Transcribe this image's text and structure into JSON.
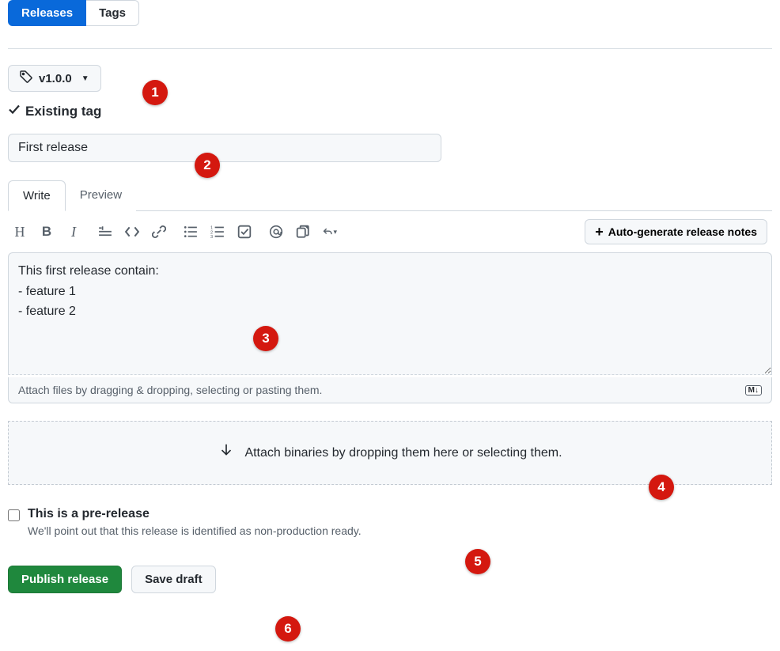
{
  "topTabs": {
    "releases": "Releases",
    "tags": "Tags"
  },
  "tagSelector": {
    "version": "v1.0.0"
  },
  "existingTag": "Existing tag",
  "titleInput": {
    "value": "First release"
  },
  "editorTabs": {
    "write": "Write",
    "preview": "Preview"
  },
  "autoGenerate": "Auto-generate release notes",
  "description": "This first release contain:\n- feature 1\n- feature 2",
  "attachHint": "Attach files by dragging & dropping, selecting or pasting them.",
  "mdBadge": "M↓",
  "binariesHint": "Attach binaries by dropping them here or selecting them.",
  "prerelease": {
    "label": "This is a pre-release",
    "description": "We'll point out that this release is identified as non-production ready."
  },
  "buttons": {
    "publish": "Publish release",
    "saveDraft": "Save draft"
  },
  "annotations": {
    "1": "1",
    "2": "2",
    "3": "3",
    "4": "4",
    "5": "5",
    "6": "6"
  }
}
